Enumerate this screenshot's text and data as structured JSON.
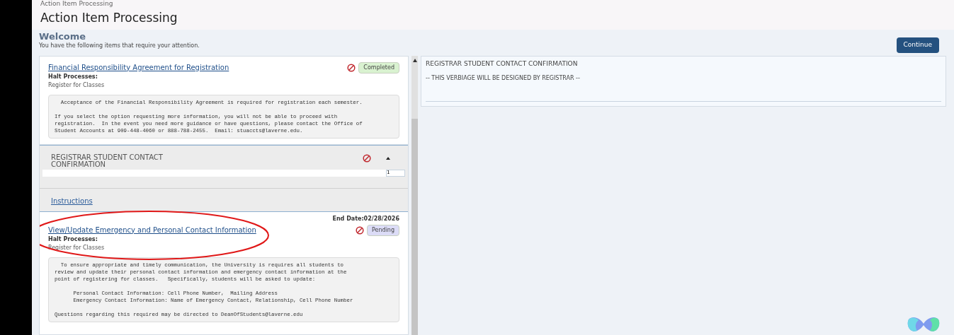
{
  "breadcrumb": "Action Item Processing",
  "title": "Action Item Processing",
  "welcome": {
    "heading": "Welcome",
    "subtitle": "You have the following items that require your attention."
  },
  "continue_button": "Continue",
  "items": [
    {
      "kind": "action",
      "title": "Financial Responsibility Agreement for Registration",
      "status": "Completed",
      "color": "#d9f2d0",
      "halt_label": "Halt Processes:",
      "process": "Register for Classes",
      "body": [
        "  Acceptance of the Financial Responsibility Agreement is required for registration each semester.",
        "If you select the option requesting more information, you will not be able to proceed with\nregistration.  In the event you need more guidance or have questions, please contact the Office of\nStudent Accounts at 909-448-4060 or 888-788-2455.  Email: stuaccts@laverne.edu."
      ]
    },
    {
      "kind": "accordion",
      "title": "REGISTRAR STUDENT CONTACT CONFIRMATION",
      "expanded": true,
      "value": "1",
      "link": "Instructions"
    },
    {
      "kind": "action",
      "end_date": "End Date:02/28/2026",
      "title": "View/Update Emergency and Personal Contact Information",
      "status": "Pending",
      "color": "#dcdcf7",
      "halt_label": "Halt Processes:",
      "process": "Register for Classes",
      "body": [
        "  To ensure appropriate and timely communication, the University is requires all students to\nreview and update their personal contact information and emergency contact information at the\npoint of registering for classes.   Specifically, students will be asked to update:",
        "      Personal Contact Information: Cell Phone Number,  Mailing Address\n      Emergency Contact Information: Name of Emergency Contact, Relationship, Cell Phone Number",
        "Questions regarding this required may be directed to DeanOfStudents@laverne.edu"
      ]
    }
  ],
  "detail": {
    "title": "REGISTRAR STUDENT CONTACT CONFIRMATION",
    "text": "-- THIS VERBIAGE WILL BE DESIGNED BY REGISTRAR --"
  }
}
